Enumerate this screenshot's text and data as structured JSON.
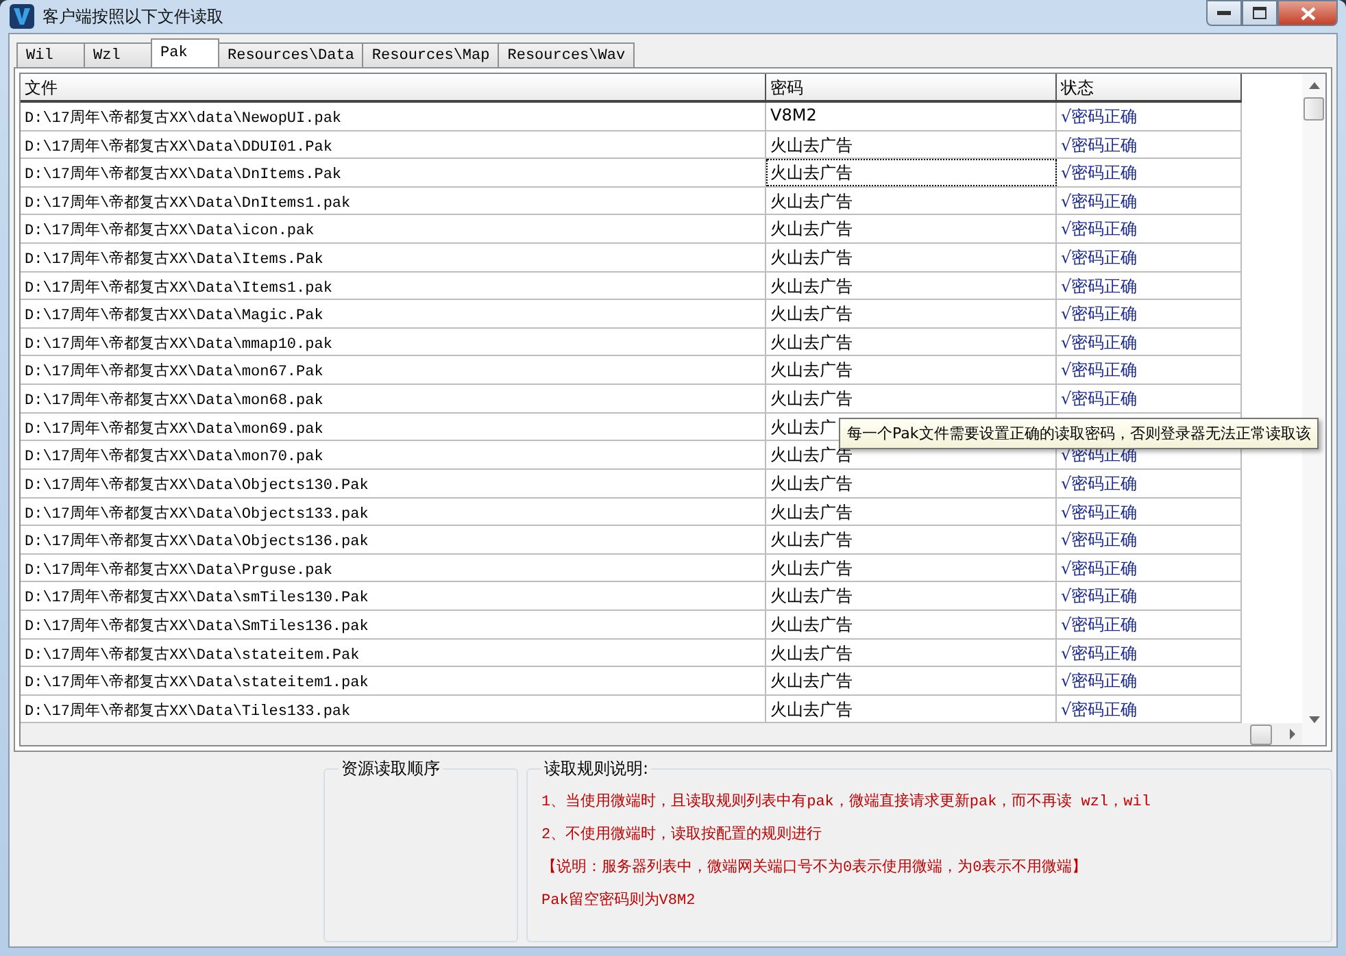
{
  "window": {
    "title": "客户端按照以下文件读取"
  },
  "tabs": [
    {
      "label": "Wil",
      "selected": false
    },
    {
      "label": "Wzl",
      "selected": false
    },
    {
      "label": "Pak",
      "selected": true
    },
    {
      "label": "Resources\\Data",
      "selected": false
    },
    {
      "label": "Resources\\Map",
      "selected": false
    },
    {
      "label": "Resources\\Wav",
      "selected": false
    }
  ],
  "table": {
    "columns": [
      "文件",
      "密码",
      "状态"
    ],
    "rows": [
      {
        "file": "D:\\17周年\\帝都复古XX\\data\\NewopUI.pak",
        "password": "V8M2",
        "status": "√密码正确",
        "focused": false
      },
      {
        "file": "D:\\17周年\\帝都复古XX\\Data\\DDUI01.Pak",
        "password": "火山去广告",
        "status": "√密码正确",
        "focused": false
      },
      {
        "file": "D:\\17周年\\帝都复古XX\\Data\\DnItems.Pak",
        "password": "火山去广告",
        "status": "√密码正确",
        "focused": true
      },
      {
        "file": "D:\\17周年\\帝都复古XX\\Data\\DnItems1.pak",
        "password": "火山去广告",
        "status": "√密码正确",
        "focused": false
      },
      {
        "file": "D:\\17周年\\帝都复古XX\\Data\\icon.pak",
        "password": "火山去广告",
        "status": "√密码正确",
        "focused": false
      },
      {
        "file": "D:\\17周年\\帝都复古XX\\Data\\Items.Pak",
        "password": "火山去广告",
        "status": "√密码正确",
        "focused": false
      },
      {
        "file": "D:\\17周年\\帝都复古XX\\Data\\Items1.pak",
        "password": "火山去广告",
        "status": "√密码正确",
        "focused": false
      },
      {
        "file": "D:\\17周年\\帝都复古XX\\Data\\Magic.Pak",
        "password": "火山去广告",
        "status": "√密码正确",
        "focused": false
      },
      {
        "file": "D:\\17周年\\帝都复古XX\\Data\\mmap10.pak",
        "password": "火山去广告",
        "status": "√密码正确",
        "focused": false
      },
      {
        "file": "D:\\17周年\\帝都复古XX\\Data\\mon67.Pak",
        "password": "火山去广告",
        "status": "√密码正确",
        "focused": false
      },
      {
        "file": "D:\\17周年\\帝都复古XX\\Data\\mon68.pak",
        "password": "火山去广告",
        "status": "√密码正确",
        "focused": false
      },
      {
        "file": "D:\\17周年\\帝都复古XX\\Data\\mon69.pak",
        "password": "火山去广",
        "focused": false
      },
      {
        "file": "D:\\17周年\\帝都复古XX\\Data\\mon70.pak",
        "password": "火山去广告",
        "status": "√密码正确",
        "focused": false
      },
      {
        "file": "D:\\17周年\\帝都复古XX\\Data\\Objects130.Pak",
        "password": "火山去广告",
        "status": "√密码正确",
        "focused": false
      },
      {
        "file": "D:\\17周年\\帝都复古XX\\Data\\Objects133.pak",
        "password": "火山去广告",
        "status": "√密码正确",
        "focused": false
      },
      {
        "file": "D:\\17周年\\帝都复古XX\\Data\\Objects136.pak",
        "password": "火山去广告",
        "status": "√密码正确",
        "focused": false
      },
      {
        "file": "D:\\17周年\\帝都复古XX\\Data\\Prguse.pak",
        "password": "火山去广告",
        "status": "√密码正确",
        "focused": false
      },
      {
        "file": "D:\\17周年\\帝都复古XX\\Data\\smTiles130.Pak",
        "password": "火山去广告",
        "status": "√密码正确",
        "focused": false
      },
      {
        "file": "D:\\17周年\\帝都复古XX\\Data\\SmTiles136.pak",
        "password": "火山去广告",
        "status": "√密码正确",
        "focused": false
      },
      {
        "file": "D:\\17周年\\帝都复古XX\\Data\\stateitem.Pak",
        "password": "火山去广告",
        "status": "√密码正确",
        "focused": false
      },
      {
        "file": "D:\\17周年\\帝都复古XX\\Data\\stateitem1.pak",
        "password": "火山去广告",
        "status": "√密码正确",
        "focused": false
      },
      {
        "file": "D:\\17周年\\帝都复古XX\\Data\\Tiles133.pak",
        "password": "火山去广告",
        "status": "√密码正确",
        "focused": false
      }
    ]
  },
  "tooltip": {
    "text": "每一个Pak文件需要设置正确的读取密码，否则登录器无法正常读取该"
  },
  "order_group": {
    "title": "资源读取顺序"
  },
  "rules_group": {
    "title": "读取规则说明:",
    "lines": [
      "1、当使用微端时，且读取规则列表中有pak，微端直接请求更新pak，而不再读 wzl，wil",
      "2、不使用微端时，读取按配置的规则进行",
      "【说明：服务器列表中，微端网关端口号不为0表示使用微端，为0表示不用微端】",
      "Pak留空密码则为V8M2"
    ]
  }
}
